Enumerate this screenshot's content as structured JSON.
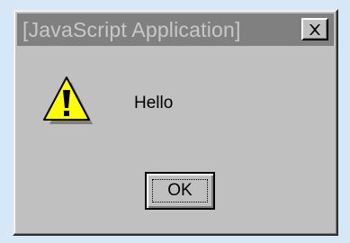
{
  "window": {
    "title": "[JavaScript Application]",
    "close_icon": "close-x-icon"
  },
  "dialog": {
    "icon": "warning-icon",
    "message": "Hello",
    "ok_label": "OK"
  },
  "colors": {
    "page_background": "#d6e8f6",
    "dialog_face": "#c0c0c0",
    "titlebar_inactive": "#808080",
    "title_text": "#c8c8c8",
    "warning_fill": "#ffff00"
  }
}
